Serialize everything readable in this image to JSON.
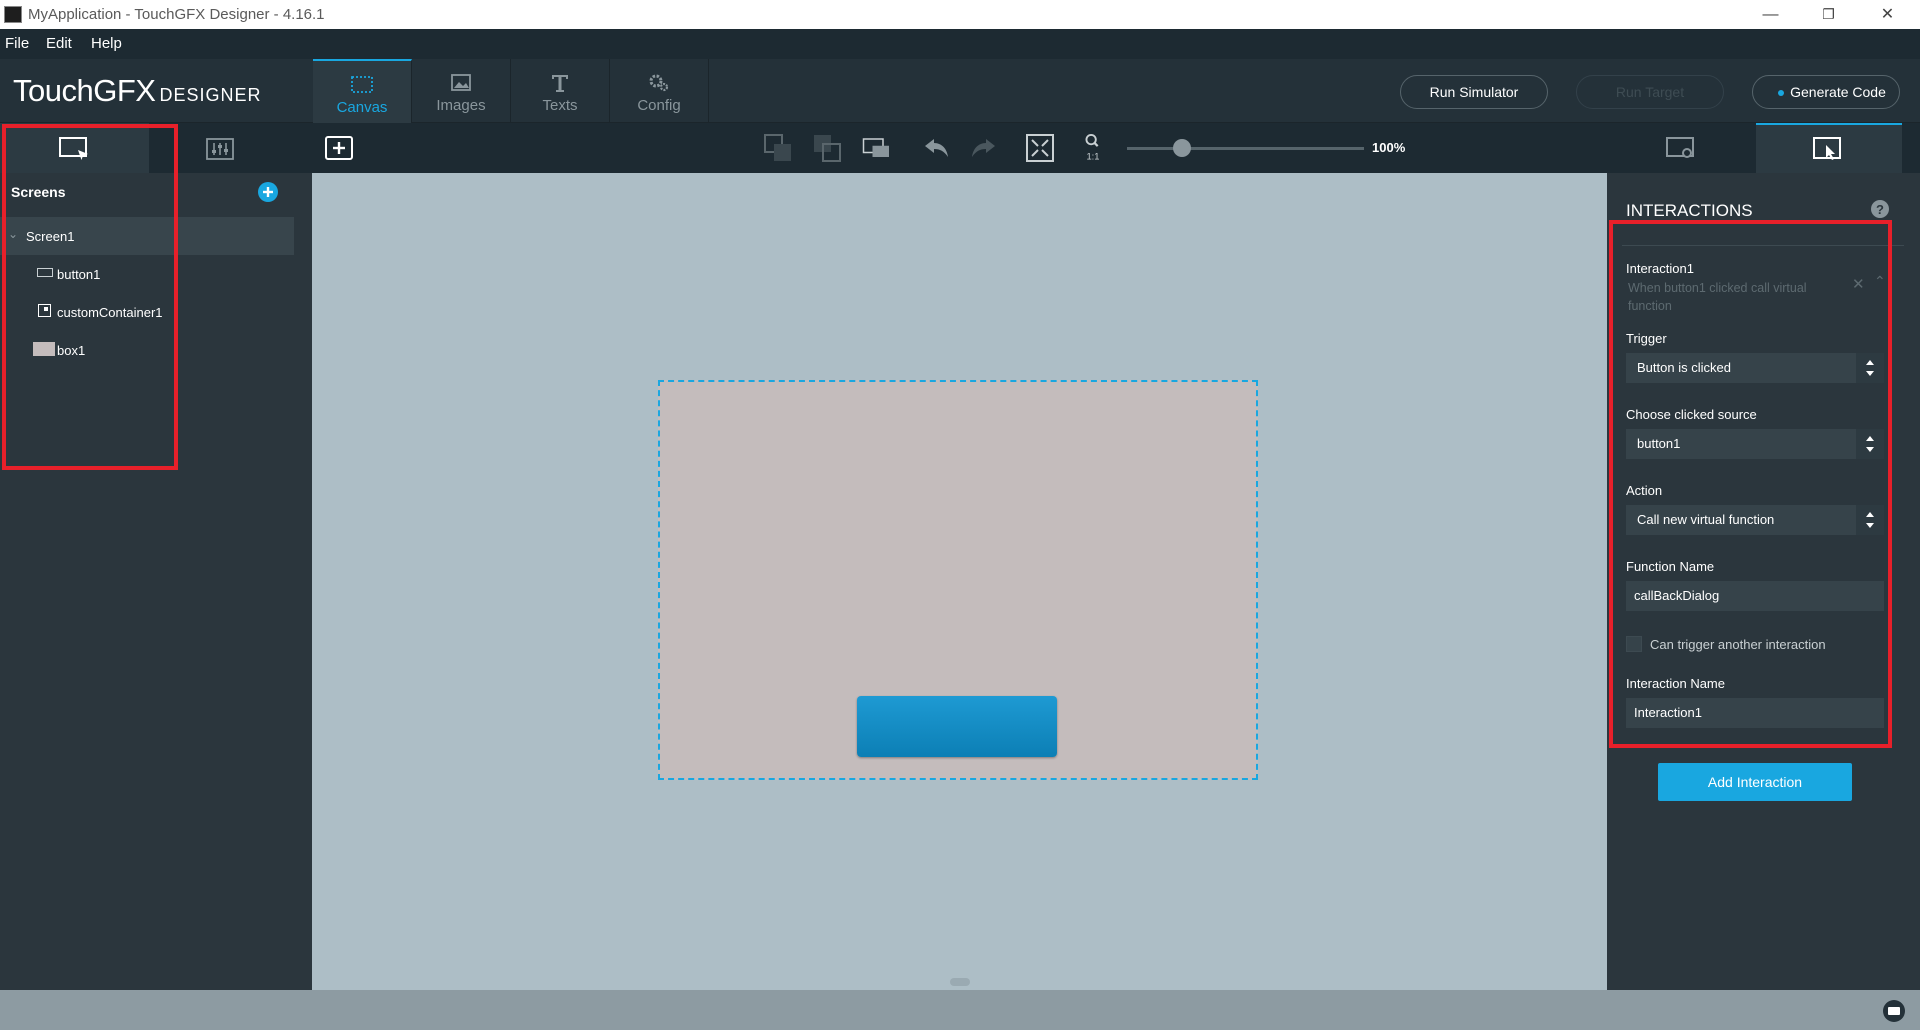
{
  "window": {
    "title": "MyApplication - TouchGFX Designer - 4.16.1",
    "controls": {
      "minimize": "—",
      "restore": "❐",
      "close": "✕"
    }
  },
  "menu": {
    "items": [
      "File",
      "Edit",
      "Help"
    ]
  },
  "logo": {
    "main": "TouchGFX",
    "sub": "DESIGNER"
  },
  "tabs": [
    {
      "label": "Canvas",
      "icon": "canvas-icon",
      "active": true
    },
    {
      "label": "Images",
      "icon": "image-icon",
      "active": false
    },
    {
      "label": "Texts",
      "icon": "text-icon",
      "active": false
    },
    {
      "label": "Config",
      "icon": "gears-icon",
      "active": false
    }
  ],
  "actions": {
    "run_simulator": "Run Simulator",
    "run_target": "Run Target",
    "generate_code": "Generate Code"
  },
  "zoom": {
    "level": "100%"
  },
  "screens_panel": {
    "title": "Screens",
    "screen": "Screen1",
    "widgets": [
      {
        "label": "button1",
        "icon": "button-widget-icon"
      },
      {
        "label": "customContainer1",
        "icon": "container-widget-icon"
      },
      {
        "label": "box1",
        "icon": "box-widget-icon"
      }
    ]
  },
  "interactions_panel": {
    "title": "INTERACTIONS",
    "interaction": {
      "name": "Interaction1",
      "description": "When button1 clicked call virtual function"
    },
    "trigger": {
      "label": "Trigger",
      "value": "Button is clicked"
    },
    "source": {
      "label": "Choose clicked source",
      "value": "button1"
    },
    "action": {
      "label": "Action",
      "value": "Call new virtual function"
    },
    "function_name": {
      "label": "Function Name",
      "value": "callBackDialog"
    },
    "can_trigger": {
      "label": "Can trigger another interaction",
      "checked": false
    },
    "interaction_name": {
      "label": "Interaction Name",
      "value": "Interaction1"
    },
    "add_button": "Add Interaction"
  },
  "colors": {
    "accent": "#19a7e0",
    "highlight_box": "#e8202a",
    "canvas_bg": "#adbec6",
    "screen_bg": "#c4bcbc",
    "button": "#1587bf"
  }
}
